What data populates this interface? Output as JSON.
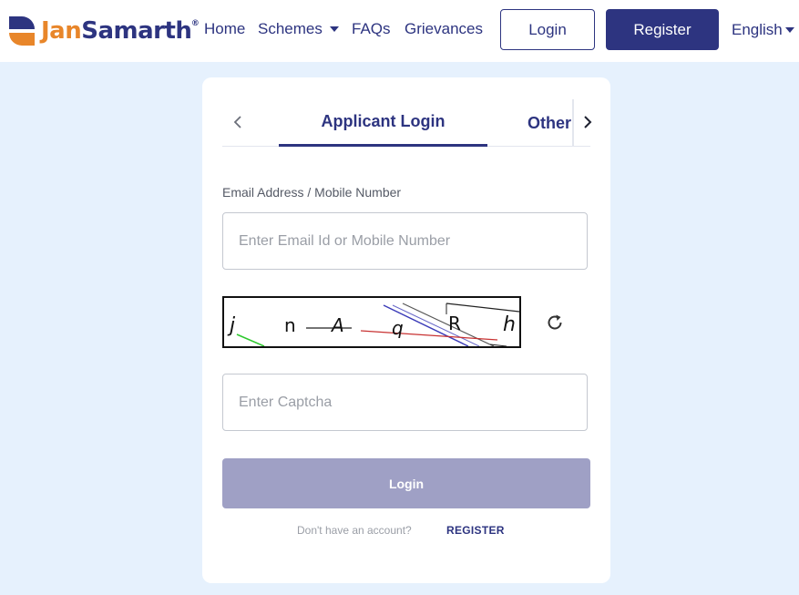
{
  "header": {
    "logo_text_part1": "Jan",
    "logo_text_part2": "Samarth",
    "logo_registered": "®",
    "nav": {
      "home": "Home",
      "schemes": "Schemes",
      "faqs": "FAQs",
      "grievances": "Grievances"
    },
    "login_label": "Login",
    "register_label": "Register",
    "language": "English"
  },
  "login_card": {
    "tabs": {
      "active": "Applicant Login",
      "other": "Other"
    },
    "email_label": "Email Address / Mobile Number",
    "email_placeholder": "Enter Email Id or Mobile Number",
    "captcha_text": "jnAqRh",
    "captcha_placeholder": "Enter Captcha",
    "login_button": "Login",
    "no_account_text": "Don't have an account?",
    "register_link": "REGISTER"
  },
  "colors": {
    "brand_navy": "#2d3480",
    "brand_orange": "#e8862a",
    "page_background": "#e6f1fd",
    "disabled_button": "#9fa0c5"
  },
  "icons": [
    "logo-mark-icon",
    "chevron-left-icon",
    "chevron-right-icon",
    "refresh-icon",
    "caret-down-icon"
  ]
}
